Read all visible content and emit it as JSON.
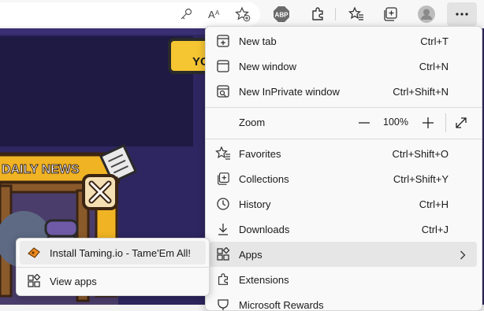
{
  "toolbar": {
    "icons": [
      "key-icon",
      "read-aloud-icon",
      "add-favorite-icon",
      "adblock-plus-icon",
      "extensions-icon",
      "favorites-icon",
      "collections-icon",
      "profile-icon",
      "more-icon"
    ],
    "adblock_label": "ABP"
  },
  "game_banner": {
    "daily_news": "DAILY NEWS",
    "top_tab": "YO"
  },
  "menu": {
    "items": [
      {
        "label": "New tab",
        "shortcut": "Ctrl+T",
        "icon": "new-tab-icon"
      },
      {
        "label": "New window",
        "shortcut": "Ctrl+N",
        "icon": "new-window-icon"
      },
      {
        "label": "New InPrivate window",
        "shortcut": "Ctrl+Shift+N",
        "icon": "inprivate-icon"
      },
      {
        "label": "Favorites",
        "shortcut": "Ctrl+Shift+O",
        "icon": "favorites-icon"
      },
      {
        "label": "Collections",
        "shortcut": "Ctrl+Shift+Y",
        "icon": "collections-icon"
      },
      {
        "label": "History",
        "shortcut": "Ctrl+H",
        "icon": "history-icon"
      },
      {
        "label": "Downloads",
        "shortcut": "Ctrl+J",
        "icon": "download-icon"
      },
      {
        "label": "Apps",
        "shortcut": "",
        "icon": "apps-icon"
      },
      {
        "label": "Extensions",
        "shortcut": "",
        "icon": "extensions-icon"
      },
      {
        "label": "Microsoft Rewards",
        "shortcut": "",
        "icon": "rewards-icon"
      }
    ],
    "zoom": {
      "label": "Zoom",
      "value": "100%",
      "minus": "—",
      "plus": "+"
    }
  },
  "apps_submenu": {
    "items": [
      {
        "label": "Install Taming.io - Tame'Em All!",
        "icon": "taming-io-icon"
      },
      {
        "label": "View apps",
        "icon": "apps-grid-icon"
      }
    ]
  }
}
